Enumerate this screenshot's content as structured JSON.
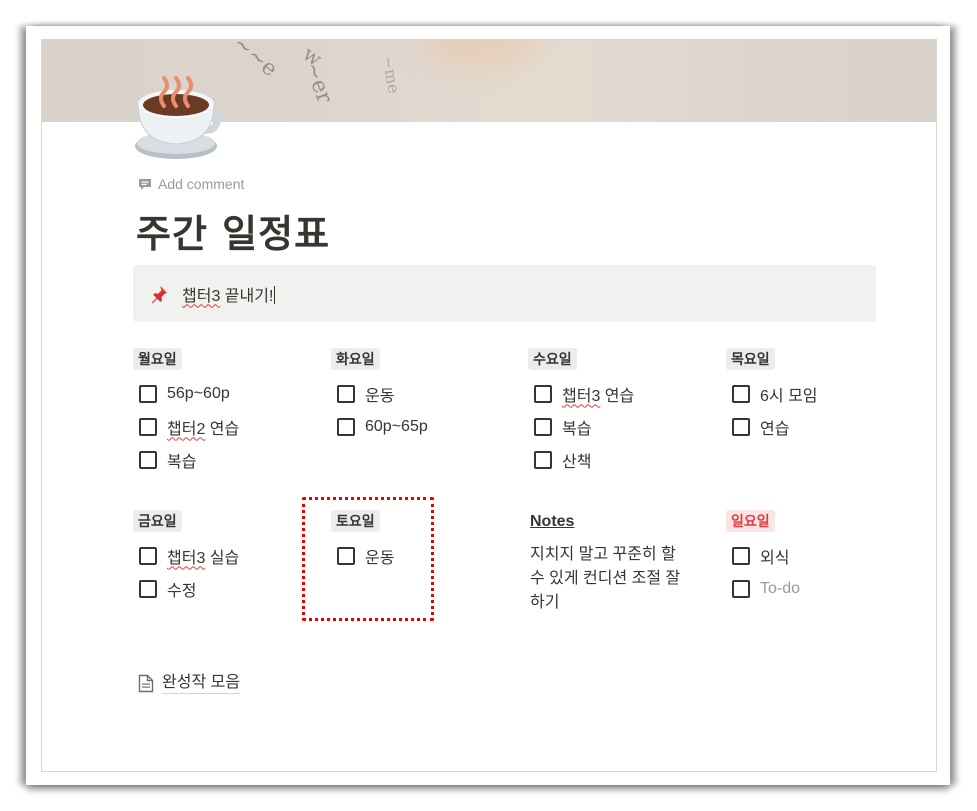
{
  "page": {
    "title": "주간 일정표",
    "add_comment": "Add comment",
    "icon": "coffee-cup-icon"
  },
  "callout": {
    "icon": "pushpin-icon",
    "text_a": "챕터3",
    "text_b": " 끝내기!"
  },
  "days": [
    {
      "label": "월요일",
      "items": [
        {
          "a": "",
          "b": "56p~60p"
        },
        {
          "a": "챕터2",
          "b": " 연습"
        },
        {
          "a": "",
          "b": "복습"
        }
      ]
    },
    {
      "label": "화요일",
      "items": [
        {
          "a": "",
          "b": "운동"
        },
        {
          "a": "",
          "b": "60p~65p"
        }
      ]
    },
    {
      "label": "수요일",
      "items": [
        {
          "a": "챕터3",
          "b": " 연습"
        },
        {
          "a": "",
          "b": "복습"
        },
        {
          "a": "",
          "b": "산책"
        }
      ]
    },
    {
      "label": "목요일",
      "items": [
        {
          "a": "",
          "b": "6시 모임"
        },
        {
          "a": "",
          "b": "연습"
        }
      ]
    },
    {
      "label": "금요일",
      "items": [
        {
          "a": "챕터3",
          "b": " 실습"
        },
        {
          "a": "",
          "b": "수정"
        }
      ]
    },
    {
      "label": "토요일",
      "items": [
        {
          "a": "",
          "b": "운동"
        }
      ]
    },
    {
      "label": "일요일",
      "items": [
        {
          "a": "",
          "b": "외식"
        },
        {
          "a": "",
          "b": "To-do",
          "placeholder": true
        }
      ]
    }
  ],
  "notes": {
    "heading": "Notes",
    "body": "지치지 말고 꾸준히 할 수 있게 컨디션 조절 잘하기"
  },
  "subpage": {
    "label": "완성작 모음",
    "icon": "page-icon"
  },
  "colors": {
    "text": "#37352f",
    "muted": "#9b9a97",
    "callout_bg": "#f1f1ef",
    "label_bg": "#ebeced",
    "sunday_red": "#e03e3e",
    "highlight_border": "#e60000"
  }
}
